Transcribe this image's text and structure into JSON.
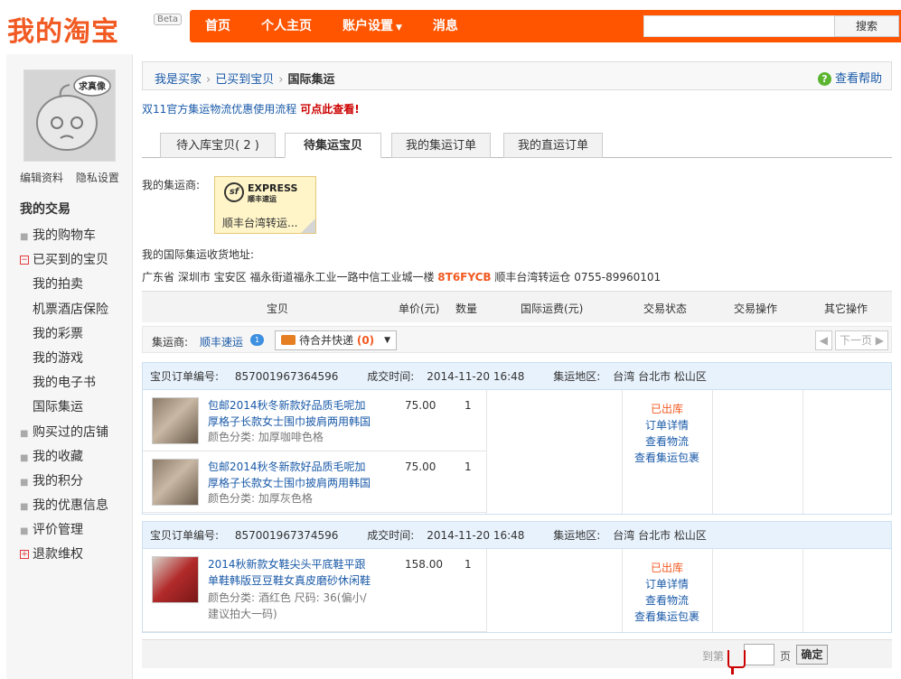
{
  "header": {
    "logo": "我的淘宝",
    "beta": "Beta",
    "nav": [
      "首页",
      "个人主页",
      "账户设置",
      "消息"
    ],
    "search_button": "搜索",
    "search_value": ""
  },
  "sidebar": {
    "edit_profile": "编辑资料",
    "privacy": "隐私设置",
    "avatar_tag": "求真像",
    "section_title": "我的交易",
    "items": [
      {
        "label": "我的购物车",
        "marker": "dot"
      },
      {
        "label": "已买到的宝贝",
        "marker": "minus"
      },
      {
        "label": "我的拍卖",
        "marker": "sub"
      },
      {
        "label": "机票酒店保险",
        "marker": "sub"
      },
      {
        "label": "我的彩票",
        "marker": "sub"
      },
      {
        "label": "我的游戏",
        "marker": "sub"
      },
      {
        "label": "我的电子书",
        "marker": "sub"
      },
      {
        "label": "国际集运",
        "marker": "sub"
      },
      {
        "label": "购买过的店铺",
        "marker": "dot"
      },
      {
        "label": "我的收藏",
        "marker": "dot"
      },
      {
        "label": "我的积分",
        "marker": "dot"
      },
      {
        "label": "我的优惠信息",
        "marker": "dot"
      },
      {
        "label": "评价管理",
        "marker": "dot"
      },
      {
        "label": "退款维权",
        "marker": "plus"
      }
    ]
  },
  "breadcrumb": {
    "items": [
      "我是买家",
      "已买到宝贝",
      "国际集运"
    ],
    "help": "查看帮助"
  },
  "notice": {
    "text": "双11官方集运物流优惠使用流程",
    "link": "可点此查看!"
  },
  "tabs": [
    "待入库宝贝( 2 )",
    "待集运宝贝",
    "我的集运订单",
    "我的直运订单"
  ],
  "carrier": {
    "label": "我的集运商:",
    "logo_text": "EXPRESS",
    "logo_sub": "顺丰速运",
    "logo_mark": "sf",
    "name": "顺丰台湾转运..."
  },
  "address": {
    "label": "我的国际集运收货地址:",
    "prefix": "广东省 深圳市 宝安区 福永街道福永工业一路中信工业城一楼",
    "code": "8T6FYCB",
    "suffix": "顺丰台湾转运仓 0755-89960101"
  },
  "table_headers": [
    "宝贝",
    "单价(元)",
    "数量",
    "国际运费(元)",
    "交易状态",
    "交易操作",
    "其它操作"
  ],
  "filter": {
    "label": "集运商:",
    "carrier": "顺丰速运",
    "badge": "1",
    "dropdown": "待合并快递",
    "count": "(0)",
    "pager_next": "下一页"
  },
  "orders": [
    {
      "order_no_label": "宝贝订单编号:",
      "order_no": "857001967364596",
      "time_label": "成交时间:",
      "time": "2014-11-20 16:48",
      "region_label": "集运地区:",
      "region": "台湾 台北市 松山区",
      "items": [
        {
          "title": "包邮2014秋冬新款好品质毛呢加厚格子长款女士围巾披肩两用韩国",
          "sku": "颜色分类: 加厚咖啡色格",
          "price": "75.00",
          "qty": "1"
        },
        {
          "title": "包邮2014秋冬新款好品质毛呢加厚格子长款女士围巾披肩两用韩国",
          "sku": "颜色分类: 加厚灰色格",
          "price": "75.00",
          "qty": "1"
        }
      ],
      "status": "已出库",
      "actions": [
        "订单详情",
        "查看物流",
        "查看集运包裹"
      ]
    },
    {
      "order_no_label": "宝贝订单编号:",
      "order_no": "857001967374596",
      "time_label": "成交时间:",
      "time": "2014-11-20 16:48",
      "region_label": "集运地区:",
      "region": "台湾 台北市 松山区",
      "items": [
        {
          "title": "2014秋新款女鞋尖头平底鞋平跟单鞋韩版豆豆鞋女真皮磨砂休闲鞋",
          "sku": "颜色分类: 酒红色 尺码: 36(偏小/建议拍大一码)",
          "price": "158.00",
          "qty": "1"
        }
      ],
      "status": "已出库",
      "actions": [
        "订单详情",
        "查看物流",
        "查看集运包裹"
      ]
    }
  ],
  "bottom_pager": {
    "goto": "到第",
    "page": "页",
    "ok": "确定"
  }
}
